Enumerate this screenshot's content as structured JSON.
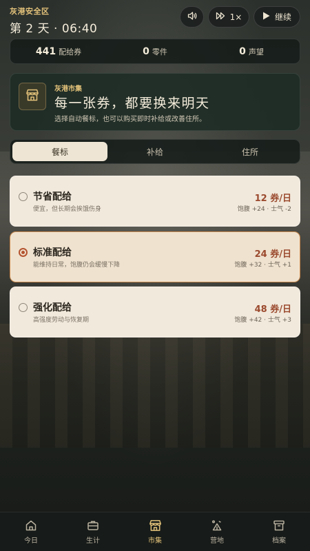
{
  "header": {
    "zone": "灰港安全区",
    "daytime": "第 2 天 · 06:40",
    "speed_label": "1×",
    "continue_label": "继续"
  },
  "resources": [
    {
      "value": "441",
      "label": "配给券"
    },
    {
      "value": "0",
      "label": "零件"
    },
    {
      "value": "0",
      "label": "声望"
    }
  ],
  "market": {
    "tag": "灰港市集",
    "title": "每一张券，都要换来明天",
    "desc": "选择自动餐标，也可以购买即时补给或改善住所。"
  },
  "tabs": [
    {
      "label": "餐标",
      "active": true
    },
    {
      "label": "补给",
      "active": false
    },
    {
      "label": "住所",
      "active": false
    }
  ],
  "rations": [
    {
      "name": "节省配给",
      "desc": "便宜，但长期会挨饿伤身",
      "price": "12 券/日",
      "effect": "饱腹 +24 · 士气 -2",
      "selected": false
    },
    {
      "name": "标准配给",
      "desc": "能维持日常，饱腹仍会缓慢下降",
      "price": "24 券/日",
      "effect": "饱腹 +32 · 士气 +1",
      "selected": true
    },
    {
      "name": "强化配给",
      "desc": "高强度劳动与恢复期",
      "price": "48 券/日",
      "effect": "饱腹 +42 · 士气 +3",
      "selected": false
    }
  ],
  "nav": [
    {
      "label": "今日",
      "icon": "home-icon"
    },
    {
      "label": "生计",
      "icon": "briefcase-icon"
    },
    {
      "label": "市集",
      "icon": "shop-icon",
      "active": true
    },
    {
      "label": "营地",
      "icon": "camp-icon"
    },
    {
      "label": "档案",
      "icon": "archive-icon"
    }
  ],
  "colors": {
    "accent": "#e3c27a",
    "price": "#9b4a2e",
    "selected_border": "#c9894e",
    "radio_selected": "#b4532f"
  }
}
